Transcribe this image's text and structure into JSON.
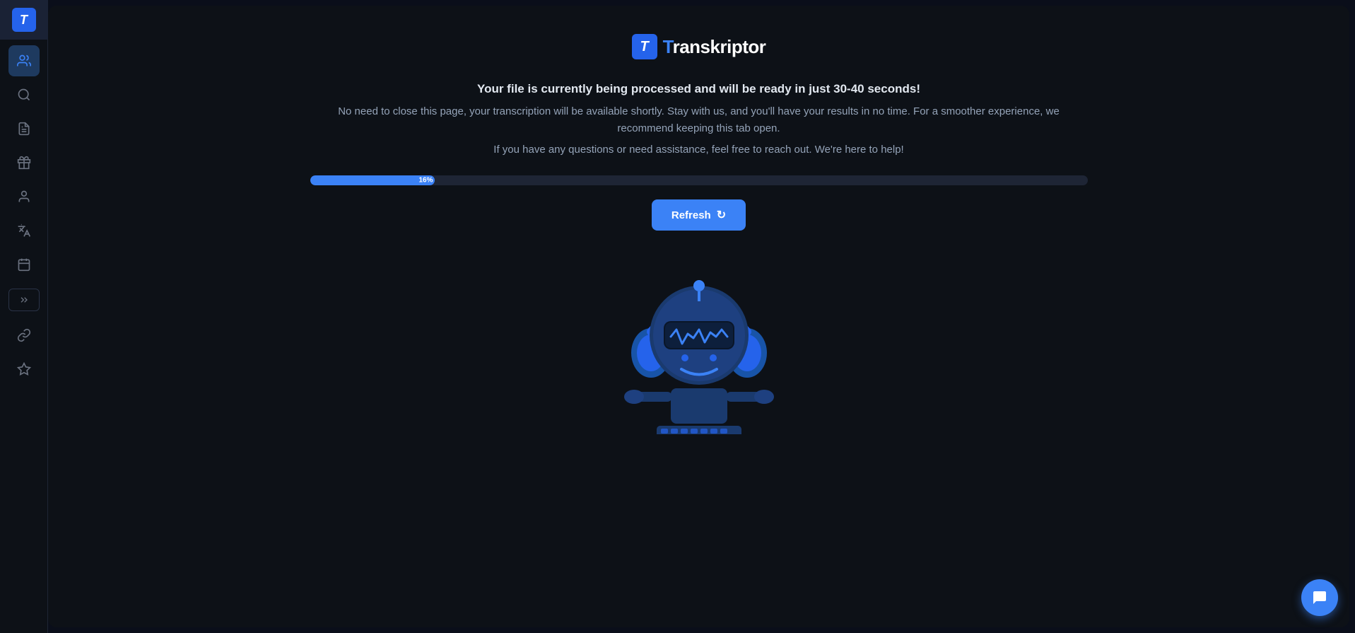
{
  "app": {
    "logo_letter": "T",
    "title_prefix": "",
    "title": "ranskriptor",
    "title_blue": "T"
  },
  "sidebar": {
    "items": [
      {
        "name": "users-icon",
        "label": "Team",
        "active": true
      },
      {
        "name": "search-icon",
        "label": "Search",
        "active": false
      },
      {
        "name": "document-icon",
        "label": "Documents",
        "active": false
      },
      {
        "name": "gift-icon",
        "label": "Gifts",
        "active": false
      },
      {
        "name": "person-icon",
        "label": "Profile",
        "active": false
      },
      {
        "name": "translate-icon",
        "label": "Translate",
        "active": false
      },
      {
        "name": "calendar-icon",
        "label": "Calendar",
        "active": false
      },
      {
        "name": "link-icon",
        "label": "Integrations",
        "active": false
      },
      {
        "name": "diamond-icon",
        "label": "Premium",
        "active": false
      }
    ],
    "expand_label": ">>"
  },
  "main": {
    "message_line1": "Your file is currently being processed and will be ready in just 30-40 seconds!",
    "message_line2": "No need to close this page, your transcription will be available shortly. Stay with us, and you'll have your results in no time. For a smoother experience, we recommend keeping this tab open.",
    "message_line3": "If you have any questions or need assistance, feel free to reach out. We're here to help!",
    "progress_percent": 16,
    "progress_label": "16%",
    "refresh_button": "Refresh"
  },
  "colors": {
    "accent": "#3b82f6",
    "bg_dark": "#0a0e1a",
    "bg_panel": "#0d1117",
    "text_primary": "#e2e8f0",
    "text_secondary": "#94a3b8",
    "progress_track": "#1e2535"
  }
}
